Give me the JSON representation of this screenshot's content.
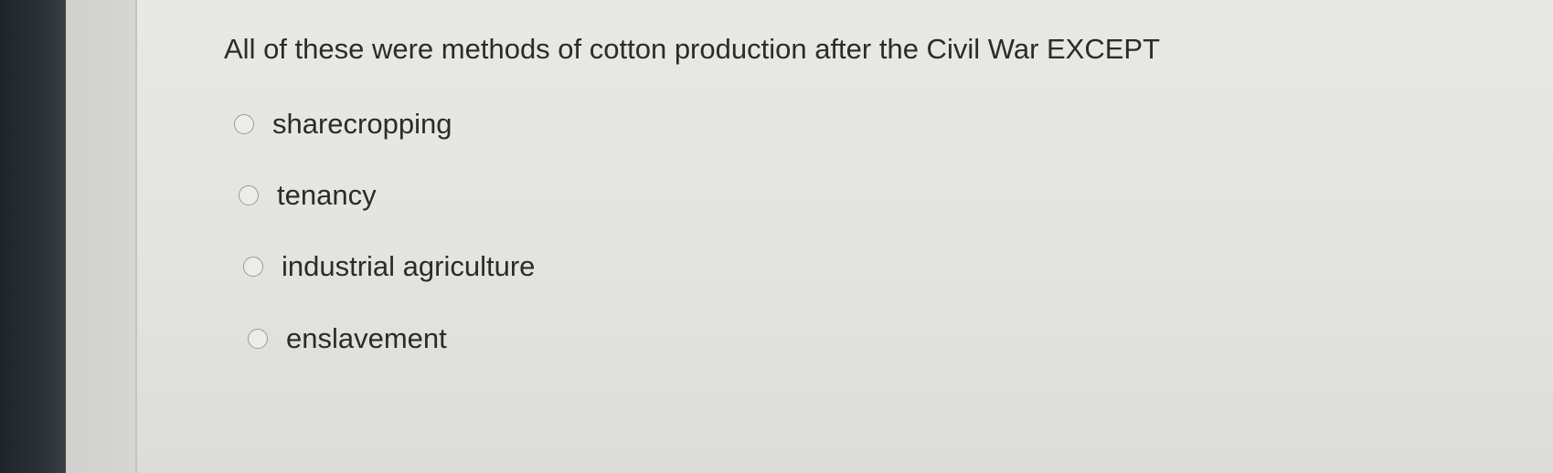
{
  "question": {
    "text": "All of these were methods of cotton production after the Civil War EXCEPT"
  },
  "options": [
    {
      "label": "sharecropping",
      "selected": false
    },
    {
      "label": "tenancy",
      "selected": false
    },
    {
      "label": "industrial agriculture",
      "selected": false
    },
    {
      "label": "enslavement",
      "selected": false
    }
  ]
}
